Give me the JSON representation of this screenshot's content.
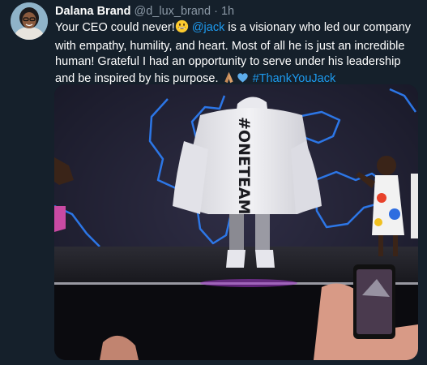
{
  "author": {
    "display_name": "Dalana Brand",
    "handle": "@d_lux_brand",
    "separator": "·",
    "time": "1h"
  },
  "tweet": {
    "part1": "Your CEO could never!",
    "mention": "@jack",
    "part2": " is a visionary who led our company with empathy, humility, and heart. Most of all he is just an incredible human! Grateful I had an opportunity to serve under his leadership and be inspired by his purpose. ",
    "hashtag": "#ThankYouJack"
  },
  "media": {
    "coat_text": "#ONETEAM"
  },
  "colors": {
    "background": "#15202b",
    "link": "#1d9bf0",
    "muted": "#8b98a5"
  },
  "icons": [
    "grinning-face-emoji",
    "folded-hands-emoji",
    "blue-heart-emoji"
  ]
}
